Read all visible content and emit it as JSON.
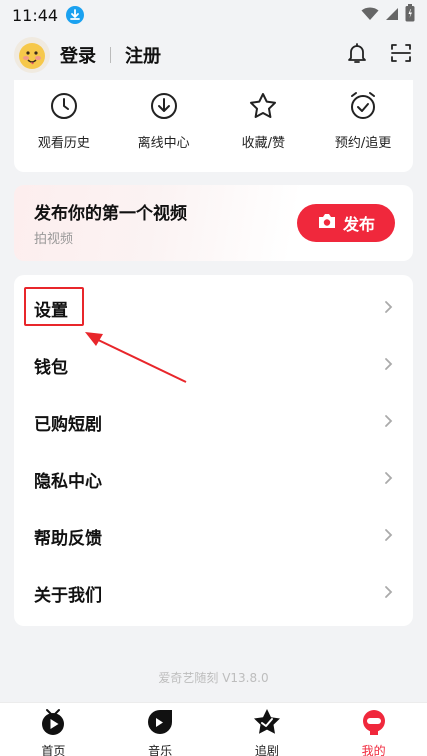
{
  "status_bar": {
    "time": "11:44",
    "icons": [
      "download-badge-icon",
      "wifi-icon",
      "signal-icon",
      "battery-icon"
    ]
  },
  "header": {
    "login_label": "登录",
    "register_label": "注册",
    "icons": [
      "avatar",
      "bell-icon",
      "scan-icon"
    ]
  },
  "quick_actions": [
    {
      "label": "观看历史",
      "icon": "clock-icon"
    },
    {
      "label": "离线中心",
      "icon": "cloud-download-icon"
    },
    {
      "label": "收藏/赞",
      "icon": "star-icon"
    },
    {
      "label": "预约/追更",
      "icon": "alarm-check-icon"
    }
  ],
  "publish": {
    "title": "发布你的第一个视频",
    "subtitle": "拍视频",
    "button_label": "发布",
    "button_color": "#f0283c"
  },
  "menu": [
    {
      "label": "设置"
    },
    {
      "label": "钱包"
    },
    {
      "label": "已购短剧"
    },
    {
      "label": "隐私中心"
    },
    {
      "label": "帮助反馈"
    },
    {
      "label": "关于我们"
    }
  ],
  "version": "爱奇艺随刻 V13.8.0",
  "bottom_nav": [
    {
      "label": "首页",
      "icon": "home-play-icon",
      "active": false
    },
    {
      "label": "音乐",
      "icon": "music-icon",
      "active": false
    },
    {
      "label": "追剧",
      "icon": "drama-star-icon",
      "active": false
    },
    {
      "label": "我的",
      "icon": "profile-icon",
      "active": true
    }
  ],
  "colors": {
    "accent": "#f0283c",
    "highlight": "#e8262b"
  }
}
